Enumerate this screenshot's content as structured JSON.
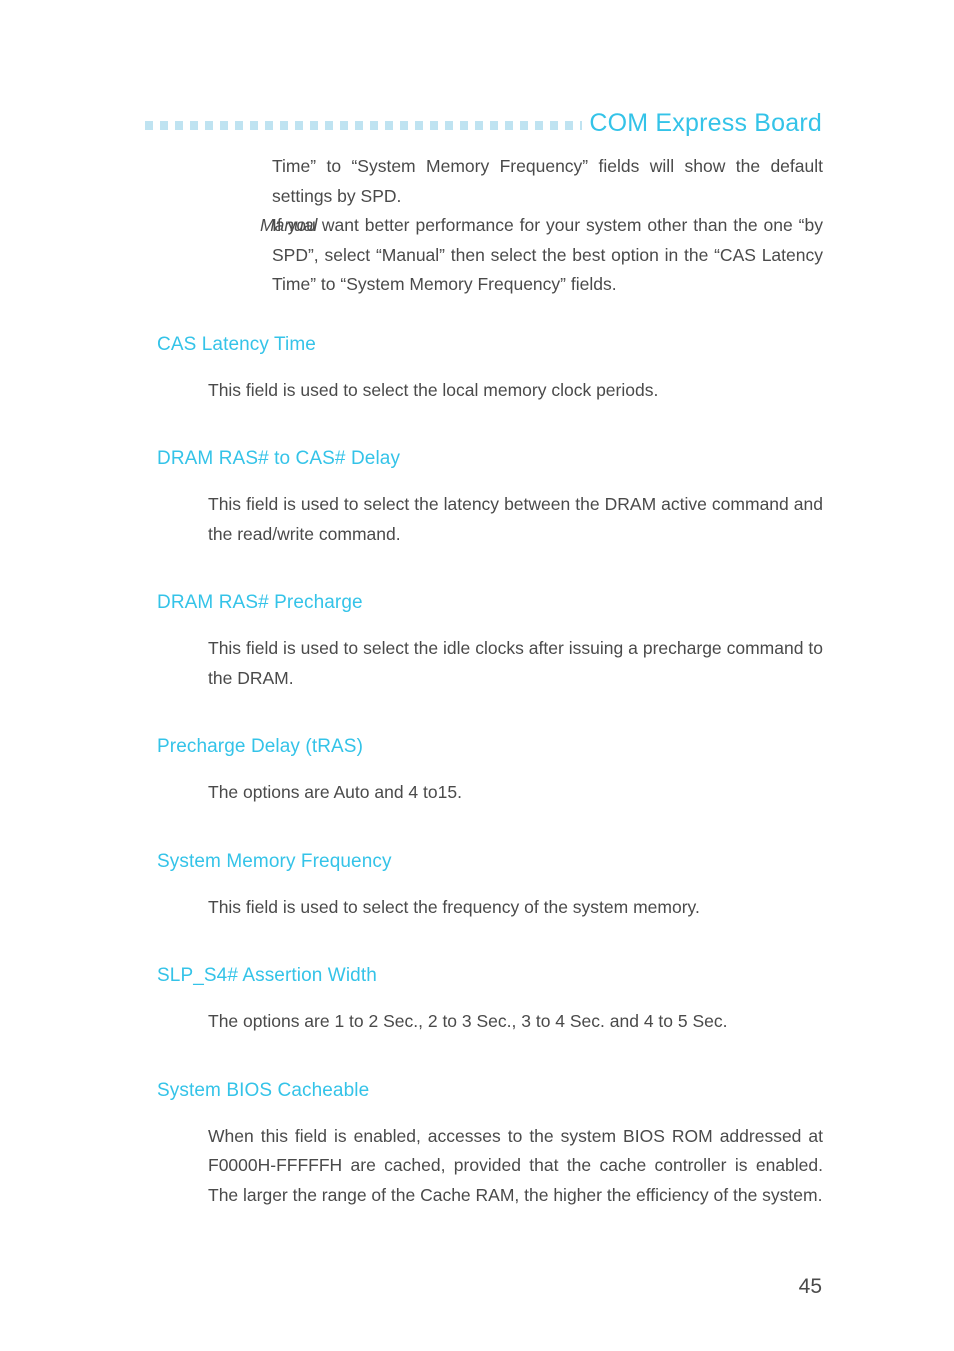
{
  "header": {
    "title": "COM Express Board",
    "rule_style": "dotted-squares",
    "accent_color": "#34c3e8",
    "rule_color": "#bfe3f1"
  },
  "intro": {
    "continuation_lines": [
      "Time” to “System Memory Frequency” fields will",
      "show the default settings by SPD."
    ],
    "continuation_text": "Time” to “System Memory Frequency” fields will show the default settings by SPD.",
    "entry": {
      "term": "Manual",
      "description": "If you want better performance for your system other than the one “by SPD”, select “Manual” then select the best option in the “CAS Latency Time” to “System Memory Frequency” fields."
    }
  },
  "sections": [
    {
      "heading": "CAS Latency Time",
      "body": "This field is used to select the local memory clock periods."
    },
    {
      "heading": "DRAM RAS# to CAS# Delay",
      "body": "This field is used to select the latency between the DRAM active command and the read/write command."
    },
    {
      "heading": "DRAM RAS# Precharge",
      "body": "This field is used to select the idle clocks after issuing a precharge command to the DRAM."
    },
    {
      "heading": "Precharge Delay (tRAS)",
      "body": "The options are Auto and 4 to15."
    },
    {
      "heading": "System Memory Frequency",
      "body": " This field is used to select the frequency of the system memory."
    },
    {
      "heading": "SLP_S4# Assertion Width",
      "body": "The options are 1 to 2 Sec., 2 to 3 Sec., 3 to 4 Sec. and 4 to 5 Sec."
    },
    {
      "heading": "System BIOS Cacheable",
      "body": "When this field is enabled, accesses to the system BIOS ROM addressed at F0000H-FFFFFH are cached, provided that the cache controller is enabled. The larger the range of the Cache RAM, the higher the efficiency of the system."
    }
  ],
  "footer": {
    "page_number": "45"
  }
}
